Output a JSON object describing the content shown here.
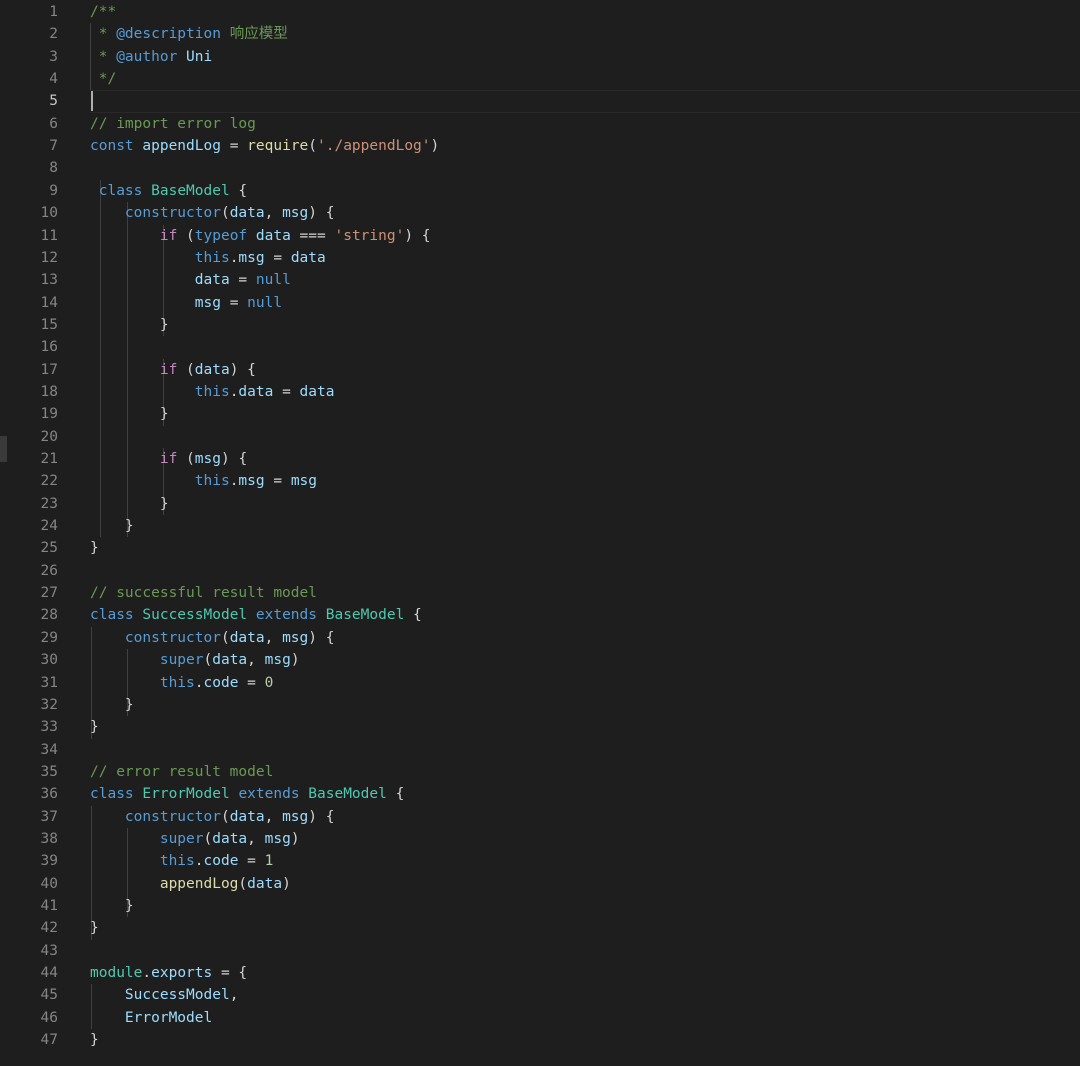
{
  "editor": {
    "active_line": 5,
    "lines": [
      {
        "n": "1",
        "tokens": [
          {
            "t": "/**",
            "c": "com"
          }
        ]
      },
      {
        "n": "2",
        "tokens": [
          {
            "t": " * ",
            "c": "com"
          },
          {
            "t": "@description",
            "c": "tag"
          },
          {
            "t": " 响应模型",
            "c": "com"
          }
        ]
      },
      {
        "n": "3",
        "tokens": [
          {
            "t": " * ",
            "c": "com"
          },
          {
            "t": "@author",
            "c": "tag"
          },
          {
            "t": " Uni",
            "c": "var"
          }
        ]
      },
      {
        "n": "4",
        "tokens": [
          {
            "t": " */",
            "c": "com"
          }
        ]
      },
      {
        "n": "5",
        "tokens": []
      },
      {
        "n": "6",
        "tokens": [
          {
            "t": "// import error log",
            "c": "com"
          }
        ]
      },
      {
        "n": "7",
        "tokens": [
          {
            "t": "const",
            "c": "kw"
          },
          {
            "t": " ",
            "c": "pun"
          },
          {
            "t": "appendLog",
            "c": "var"
          },
          {
            "t": " = ",
            "c": "pun"
          },
          {
            "t": "require",
            "c": "fn"
          },
          {
            "t": "(",
            "c": "pun"
          },
          {
            "t": "'./appendLog'",
            "c": "str"
          },
          {
            "t": ")",
            "c": "pun"
          }
        ]
      },
      {
        "n": "8",
        "tokens": []
      },
      {
        "n": "9",
        "tokens": [
          {
            "t": " class",
            "c": "kw"
          },
          {
            "t": " ",
            "c": "pun"
          },
          {
            "t": "BaseModel",
            "c": "cls"
          },
          {
            "t": " {",
            "c": "pun"
          }
        ]
      },
      {
        "n": "10",
        "tokens": [
          {
            "t": "    ",
            "c": "pun"
          },
          {
            "t": "constructor",
            "c": "kw"
          },
          {
            "t": "(",
            "c": "pun"
          },
          {
            "t": "data",
            "c": "var"
          },
          {
            "t": ", ",
            "c": "pun"
          },
          {
            "t": "msg",
            "c": "var"
          },
          {
            "t": ") {",
            "c": "pun"
          }
        ]
      },
      {
        "n": "11",
        "tokens": [
          {
            "t": "        ",
            "c": "pun"
          },
          {
            "t": "if",
            "c": "ctl"
          },
          {
            "t": " (",
            "c": "pun"
          },
          {
            "t": "typeof",
            "c": "kw"
          },
          {
            "t": " ",
            "c": "pun"
          },
          {
            "t": "data",
            "c": "var"
          },
          {
            "t": " === ",
            "c": "pun"
          },
          {
            "t": "'string'",
            "c": "str"
          },
          {
            "t": ") {",
            "c": "pun"
          }
        ]
      },
      {
        "n": "12",
        "tokens": [
          {
            "t": "            ",
            "c": "pun"
          },
          {
            "t": "this",
            "c": "kw"
          },
          {
            "t": ".",
            "c": "pun"
          },
          {
            "t": "msg",
            "c": "var"
          },
          {
            "t": " = ",
            "c": "pun"
          },
          {
            "t": "data",
            "c": "var"
          }
        ]
      },
      {
        "n": "13",
        "tokens": [
          {
            "t": "            ",
            "c": "pun"
          },
          {
            "t": "data",
            "c": "var"
          },
          {
            "t": " = ",
            "c": "pun"
          },
          {
            "t": "null",
            "c": "kw"
          }
        ]
      },
      {
        "n": "14",
        "tokens": [
          {
            "t": "            ",
            "c": "pun"
          },
          {
            "t": "msg",
            "c": "var"
          },
          {
            "t": " = ",
            "c": "pun"
          },
          {
            "t": "null",
            "c": "kw"
          }
        ]
      },
      {
        "n": "15",
        "tokens": [
          {
            "t": "        }",
            "c": "pun"
          }
        ]
      },
      {
        "n": "16",
        "tokens": []
      },
      {
        "n": "17",
        "tokens": [
          {
            "t": "        ",
            "c": "pun"
          },
          {
            "t": "if",
            "c": "ctl"
          },
          {
            "t": " (",
            "c": "pun"
          },
          {
            "t": "data",
            "c": "var"
          },
          {
            "t": ") {",
            "c": "pun"
          }
        ]
      },
      {
        "n": "18",
        "tokens": [
          {
            "t": "            ",
            "c": "pun"
          },
          {
            "t": "this",
            "c": "kw"
          },
          {
            "t": ".",
            "c": "pun"
          },
          {
            "t": "data",
            "c": "var"
          },
          {
            "t": " = ",
            "c": "pun"
          },
          {
            "t": "data",
            "c": "var"
          }
        ]
      },
      {
        "n": "19",
        "tokens": [
          {
            "t": "        }",
            "c": "pun"
          }
        ]
      },
      {
        "n": "20",
        "tokens": []
      },
      {
        "n": "21",
        "tokens": [
          {
            "t": "        ",
            "c": "pun"
          },
          {
            "t": "if",
            "c": "ctl"
          },
          {
            "t": " (",
            "c": "pun"
          },
          {
            "t": "msg",
            "c": "var"
          },
          {
            "t": ") {",
            "c": "pun"
          }
        ]
      },
      {
        "n": "22",
        "tokens": [
          {
            "t": "            ",
            "c": "pun"
          },
          {
            "t": "this",
            "c": "kw"
          },
          {
            "t": ".",
            "c": "pun"
          },
          {
            "t": "msg",
            "c": "var"
          },
          {
            "t": " = ",
            "c": "pun"
          },
          {
            "t": "msg",
            "c": "var"
          }
        ]
      },
      {
        "n": "23",
        "tokens": [
          {
            "t": "        }",
            "c": "pun"
          }
        ]
      },
      {
        "n": "24",
        "tokens": [
          {
            "t": "    }",
            "c": "pun"
          }
        ]
      },
      {
        "n": "25",
        "tokens": [
          {
            "t": "}",
            "c": "pun"
          }
        ]
      },
      {
        "n": "26",
        "tokens": []
      },
      {
        "n": "27",
        "tokens": [
          {
            "t": "// successful result model",
            "c": "com"
          }
        ]
      },
      {
        "n": "28",
        "tokens": [
          {
            "t": "class",
            "c": "kw"
          },
          {
            "t": " ",
            "c": "pun"
          },
          {
            "t": "SuccessModel",
            "c": "cls"
          },
          {
            "t": " ",
            "c": "pun"
          },
          {
            "t": "extends",
            "c": "kw"
          },
          {
            "t": " ",
            "c": "pun"
          },
          {
            "t": "BaseModel",
            "c": "cls"
          },
          {
            "t": " {",
            "c": "pun"
          }
        ]
      },
      {
        "n": "29",
        "tokens": [
          {
            "t": "    ",
            "c": "pun"
          },
          {
            "t": "constructor",
            "c": "kw"
          },
          {
            "t": "(",
            "c": "pun"
          },
          {
            "t": "data",
            "c": "var"
          },
          {
            "t": ", ",
            "c": "pun"
          },
          {
            "t": "msg",
            "c": "var"
          },
          {
            "t": ") {",
            "c": "pun"
          }
        ]
      },
      {
        "n": "30",
        "tokens": [
          {
            "t": "        ",
            "c": "pun"
          },
          {
            "t": "super",
            "c": "kw"
          },
          {
            "t": "(",
            "c": "pun"
          },
          {
            "t": "data",
            "c": "var"
          },
          {
            "t": ", ",
            "c": "pun"
          },
          {
            "t": "msg",
            "c": "var"
          },
          {
            "t": ")",
            "c": "pun"
          }
        ]
      },
      {
        "n": "31",
        "tokens": [
          {
            "t": "        ",
            "c": "pun"
          },
          {
            "t": "this",
            "c": "kw"
          },
          {
            "t": ".",
            "c": "pun"
          },
          {
            "t": "code",
            "c": "var"
          },
          {
            "t": " = ",
            "c": "pun"
          },
          {
            "t": "0",
            "c": "num"
          }
        ]
      },
      {
        "n": "32",
        "tokens": [
          {
            "t": "    }",
            "c": "pun"
          }
        ]
      },
      {
        "n": "33",
        "tokens": [
          {
            "t": "}",
            "c": "pun"
          }
        ]
      },
      {
        "n": "34",
        "tokens": []
      },
      {
        "n": "35",
        "tokens": [
          {
            "t": "// error result model",
            "c": "com"
          }
        ]
      },
      {
        "n": "36",
        "tokens": [
          {
            "t": "class",
            "c": "kw"
          },
          {
            "t": " ",
            "c": "pun"
          },
          {
            "t": "ErrorModel",
            "c": "cls"
          },
          {
            "t": " ",
            "c": "pun"
          },
          {
            "t": "extends",
            "c": "kw"
          },
          {
            "t": " ",
            "c": "pun"
          },
          {
            "t": "BaseModel",
            "c": "cls"
          },
          {
            "t": " {",
            "c": "pun"
          }
        ]
      },
      {
        "n": "37",
        "tokens": [
          {
            "t": "    ",
            "c": "pun"
          },
          {
            "t": "constructor",
            "c": "kw"
          },
          {
            "t": "(",
            "c": "pun"
          },
          {
            "t": "data",
            "c": "var"
          },
          {
            "t": ", ",
            "c": "pun"
          },
          {
            "t": "msg",
            "c": "var"
          },
          {
            "t": ") {",
            "c": "pun"
          }
        ]
      },
      {
        "n": "38",
        "tokens": [
          {
            "t": "        ",
            "c": "pun"
          },
          {
            "t": "super",
            "c": "kw"
          },
          {
            "t": "(",
            "c": "pun"
          },
          {
            "t": "data",
            "c": "var"
          },
          {
            "t": ", ",
            "c": "pun"
          },
          {
            "t": "msg",
            "c": "var"
          },
          {
            "t": ")",
            "c": "pun"
          }
        ]
      },
      {
        "n": "39",
        "tokens": [
          {
            "t": "        ",
            "c": "pun"
          },
          {
            "t": "this",
            "c": "kw"
          },
          {
            "t": ".",
            "c": "pun"
          },
          {
            "t": "code",
            "c": "var"
          },
          {
            "t": " = ",
            "c": "pun"
          },
          {
            "t": "1",
            "c": "num"
          }
        ]
      },
      {
        "n": "40",
        "tokens": [
          {
            "t": "        ",
            "c": "pun"
          },
          {
            "t": "appendLog",
            "c": "fn"
          },
          {
            "t": "(",
            "c": "pun"
          },
          {
            "t": "data",
            "c": "var"
          },
          {
            "t": ")",
            "c": "pun"
          }
        ]
      },
      {
        "n": "41",
        "tokens": [
          {
            "t": "    }",
            "c": "pun"
          }
        ]
      },
      {
        "n": "42",
        "tokens": [
          {
            "t": "}",
            "c": "pun"
          }
        ]
      },
      {
        "n": "43",
        "tokens": []
      },
      {
        "n": "44",
        "tokens": [
          {
            "t": "module",
            "c": "cls"
          },
          {
            "t": ".",
            "c": "pun"
          },
          {
            "t": "exports",
            "c": "var"
          },
          {
            "t": " = {",
            "c": "pun"
          }
        ]
      },
      {
        "n": "45",
        "tokens": [
          {
            "t": "    ",
            "c": "pun"
          },
          {
            "t": "SuccessModel",
            "c": "var"
          },
          {
            "t": ",",
            "c": "pun"
          }
        ]
      },
      {
        "n": "46",
        "tokens": [
          {
            "t": "    ",
            "c": "pun"
          },
          {
            "t": "ErrorModel",
            "c": "var"
          }
        ]
      },
      {
        "n": "47",
        "tokens": [
          {
            "t": "}",
            "c": "pun"
          }
        ]
      }
    ]
  }
}
